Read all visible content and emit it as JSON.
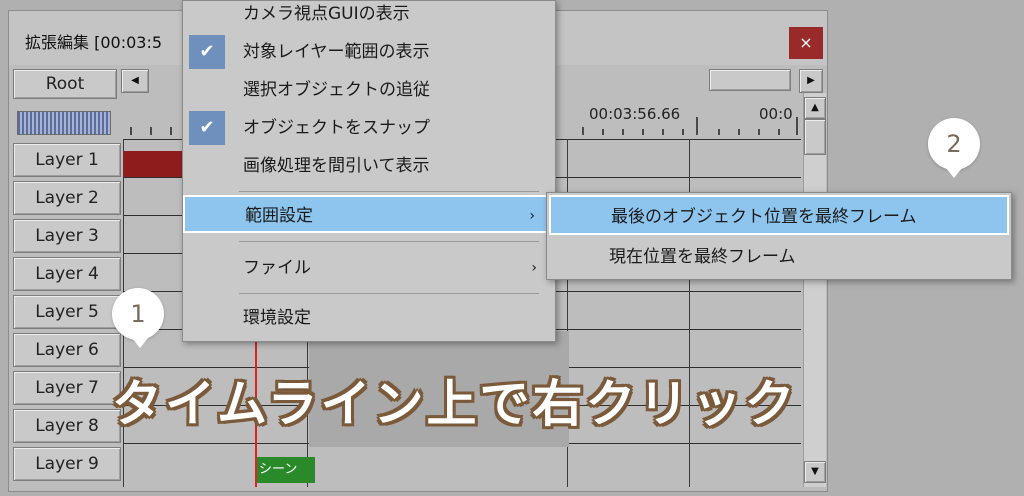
{
  "window": {
    "title": "拡張編集 [00:03:5",
    "close_icon": "×"
  },
  "toolbar": {
    "root_label": "Root",
    "scroll_left_icon": "◀",
    "scroll_right_icon": "▶"
  },
  "ruler": {
    "timestamp_1": "00:03:56.66",
    "timestamp_2": "00:0"
  },
  "vscroll": {
    "up_icon": "▲",
    "down_icon": "▼"
  },
  "layers": [
    "Layer 1",
    "Layer 2",
    "Layer 3",
    "Layer 4",
    "Layer 5",
    "Layer 6",
    "Layer 7",
    "Layer 8",
    "Layer 9"
  ],
  "timeline": {
    "scene_object_label": "シーン"
  },
  "context_menu": {
    "items": [
      {
        "label": "カメラ視点GUIの表示",
        "checked": false
      },
      {
        "label": "対象レイヤー範囲の表示",
        "checked": true
      },
      {
        "label": "選択オブジェクトの追従",
        "checked": false
      },
      {
        "label": "オブジェクトをスナップ",
        "checked": true
      },
      {
        "label": "画像処理を間引いて表示",
        "checked": false
      },
      {
        "label": "範囲設定",
        "submenu": true,
        "highlighted": true
      },
      {
        "label": "ファイル",
        "submenu": true
      },
      {
        "label": "環境設定"
      }
    ],
    "check_icon": "✔",
    "submenu_arrow": "›"
  },
  "submenu": {
    "items": [
      {
        "label": "最後のオブジェクト位置を最終フレーム",
        "highlighted": true
      },
      {
        "label": "現在位置を最終フレーム"
      }
    ]
  },
  "annotations": {
    "badge_1": "1",
    "badge_2": "2",
    "caption": "タイムライン上で右クリック"
  },
  "colors": {
    "menu_highlight": "#8ec5ef",
    "check_bg": "#6f8fbd",
    "close_button": "#9a2a2a",
    "layer1_object": "#8e1c1c",
    "scene_object": "#2a8a2a",
    "cursor": "#d22222",
    "caption_outline": "#7a5a3a"
  }
}
